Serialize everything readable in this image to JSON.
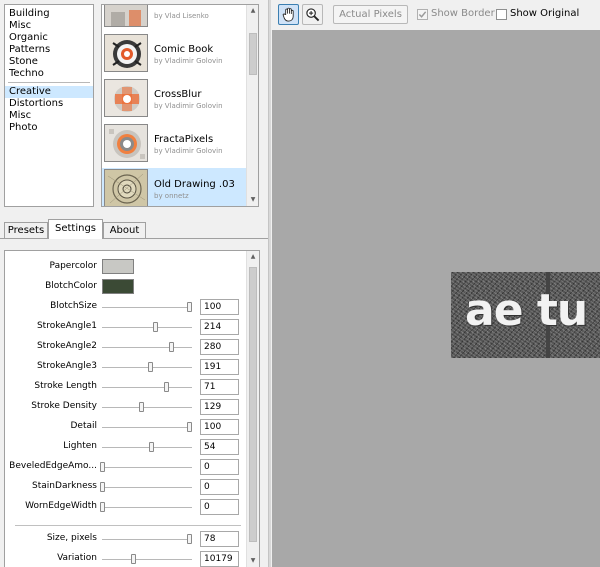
{
  "categories": {
    "group1": [
      "Building",
      "Misc",
      "Organic",
      "Patterns",
      "Stone",
      "Techno"
    ],
    "group2": [
      "Creative",
      "Distortions",
      "Misc",
      "Photo"
    ],
    "selected": "Creative"
  },
  "filters": [
    {
      "name": "",
      "author": "by Vlad Lisenko",
      "thumb": "building-thumb"
    },
    {
      "name": "Comic Book",
      "author": "by Vladimir Golovin",
      "thumb": "comic-book-thumb"
    },
    {
      "name": "CrossBlur",
      "author": "by Vladimir Golovin",
      "thumb": "crossblur-thumb"
    },
    {
      "name": "FractaPixels",
      "author": "by Vladimir Golovin",
      "thumb": "fractapixels-thumb"
    },
    {
      "name": "Old Drawing .03",
      "author": "by onnetz",
      "thumb": "old-drawing-thumb",
      "selected": true
    }
  ],
  "tabs": [
    {
      "label": "Presets",
      "active": false
    },
    {
      "label": "Settings",
      "active": true
    },
    {
      "label": "About",
      "active": false
    }
  ],
  "colors": {
    "papercolor": "#c8c8c4",
    "blotchcolor": "#3b4a35",
    "selection": "#cde8ff",
    "canvas": "#a8a8a8"
  },
  "settings": {
    "color_params": [
      {
        "label": "Papercolor",
        "color": "#c8c8c4"
      },
      {
        "label": "BlotchColor",
        "color": "#3b4a35"
      }
    ],
    "params": [
      {
        "label": "BlotchSize",
        "value": "100",
        "fraction": 0.97
      },
      {
        "label": "StrokeAngle1",
        "value": "214",
        "fraction": 0.59
      },
      {
        "label": "StrokeAngle2",
        "value": "280",
        "fraction": 0.77
      },
      {
        "label": "StrokeAngle3",
        "value": "191",
        "fraction": 0.53
      },
      {
        "label": "Stroke Length",
        "value": "71",
        "fraction": 0.71
      },
      {
        "label": "Stroke Density",
        "value": "129",
        "fraction": 0.43
      },
      {
        "label": "Detail",
        "value": "100",
        "fraction": 0.97
      },
      {
        "label": "Lighten",
        "value": "54",
        "fraction": 0.54
      },
      {
        "label": "BeveledEdgeAmo...",
        "value": "0",
        "fraction": 0.0
      },
      {
        "label": "StainDarkness",
        "value": "0",
        "fraction": 0.0
      },
      {
        "label": "WornEdgeWidth",
        "value": "0",
        "fraction": 0.0
      }
    ],
    "params2": [
      {
        "label": "Size, pixels",
        "value": "78",
        "fraction": 0.97
      },
      {
        "label": "Variation",
        "value": "10179",
        "fraction": 0.34
      }
    ]
  },
  "toolbar": {
    "hand_icon": "hand-icon",
    "zoom_icon": "zoom-in-icon",
    "actual_pixels": "Actual Pixels",
    "show_border": "Show Border",
    "show_border_checked": true,
    "show_original": "Show Original",
    "show_original_checked": false
  },
  "preview": {
    "text": "ae tu"
  }
}
